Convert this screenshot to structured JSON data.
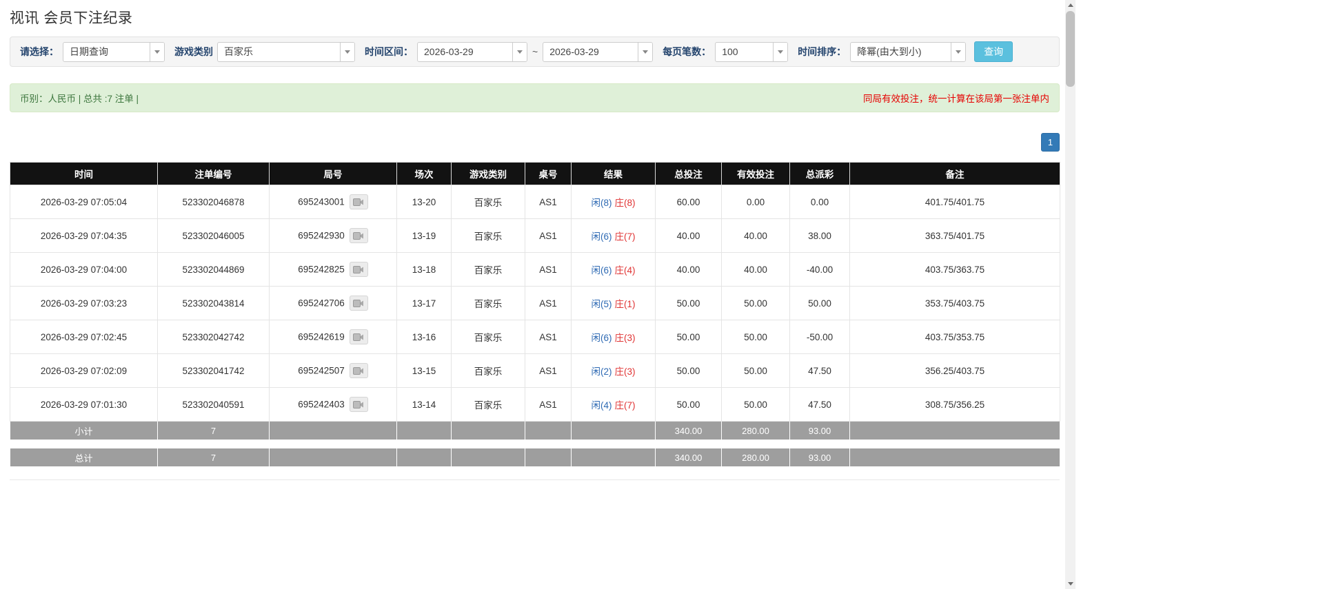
{
  "page": {
    "title": "视讯 会员下注纪录"
  },
  "filters": {
    "select_label": "请选择：",
    "select_value": "日期查询",
    "game_type_label": "游戏类别",
    "game_type_value": "百家乐",
    "time_range_label": "时间区间：",
    "date_from": "2026-03-29",
    "range_separator": "~",
    "date_to": "2026-03-29",
    "page_size_label": "每页笔数：",
    "page_size_value": "100",
    "sort_label": "时间排序：",
    "sort_value": "降幂(由大到小)",
    "search_button": "查询"
  },
  "summary": {
    "left": "币别：人民币 | 总共 :7 注单 |",
    "right": "同局有效投注，统一计算在该局第一张注单内"
  },
  "pagination": {
    "current": "1"
  },
  "table": {
    "headers": [
      "时间",
      "注单编号",
      "局号",
      "场次",
      "游戏类别",
      "桌号",
      "结果",
      "总投注",
      "有效投注",
      "总派彩",
      "备注"
    ],
    "rows": [
      {
        "time": "2026-03-29 07:05:04",
        "bet_id": "523302046878",
        "round": "695243001",
        "session": "13-20",
        "game": "百家乐",
        "table_no": "AS1",
        "player": "闲(8)",
        "banker": "庄(8)",
        "total_bet": "60.00",
        "valid_bet": "0.00",
        "payout": "0.00",
        "remark": "401.75/401.75"
      },
      {
        "time": "2026-03-29 07:04:35",
        "bet_id": "523302046005",
        "round": "695242930",
        "session": "13-19",
        "game": "百家乐",
        "table_no": "AS1",
        "player": "闲(6)",
        "banker": "庄(7)",
        "total_bet": "40.00",
        "valid_bet": "40.00",
        "payout": "38.00",
        "remark": "363.75/401.75"
      },
      {
        "time": "2026-03-29 07:04:00",
        "bet_id": "523302044869",
        "round": "695242825",
        "session": "13-18",
        "game": "百家乐",
        "table_no": "AS1",
        "player": "闲(6)",
        "banker": "庄(4)",
        "total_bet": "40.00",
        "valid_bet": "40.00",
        "payout": "-40.00",
        "remark": "403.75/363.75"
      },
      {
        "time": "2026-03-29 07:03:23",
        "bet_id": "523302043814",
        "round": "695242706",
        "session": "13-17",
        "game": "百家乐",
        "table_no": "AS1",
        "player": "闲(5)",
        "banker": "庄(1)",
        "total_bet": "50.00",
        "valid_bet": "50.00",
        "payout": "50.00",
        "remark": "353.75/403.75"
      },
      {
        "time": "2026-03-29 07:02:45",
        "bet_id": "523302042742",
        "round": "695242619",
        "session": "13-16",
        "game": "百家乐",
        "table_no": "AS1",
        "player": "闲(6)",
        "banker": "庄(3)",
        "total_bet": "50.00",
        "valid_bet": "50.00",
        "payout": "-50.00",
        "remark": "403.75/353.75"
      },
      {
        "time": "2026-03-29 07:02:09",
        "bet_id": "523302041742",
        "round": "695242507",
        "session": "13-15",
        "game": "百家乐",
        "table_no": "AS1",
        "player": "闲(2)",
        "banker": "庄(3)",
        "total_bet": "50.00",
        "valid_bet": "50.00",
        "payout": "47.50",
        "remark": "356.25/403.75"
      },
      {
        "time": "2026-03-29 07:01:30",
        "bet_id": "523302040591",
        "round": "695242403",
        "session": "13-14",
        "game": "百家乐",
        "table_no": "AS1",
        "player": "闲(4)",
        "banker": "庄(7)",
        "total_bet": "50.00",
        "valid_bet": "50.00",
        "payout": "47.50",
        "remark": "308.75/356.25"
      }
    ],
    "subtotal": {
      "label": "小计",
      "count": "7",
      "total_bet": "340.00",
      "valid_bet": "280.00",
      "payout": "93.00"
    },
    "total": {
      "label": "总计",
      "count": "7",
      "total_bet": "340.00",
      "valid_bet": "280.00",
      "payout": "93.00"
    }
  },
  "icons": {
    "dropdown": "chevron-down",
    "round_video": "video-camera",
    "scroll_up": "triangle-up",
    "scroll_down": "triangle-down"
  },
  "colors": {
    "accent_blue": "#337ab7",
    "search_button_bg": "#5bc0de",
    "summary_bg": "#dff0d8",
    "summary_text": "#3c763d",
    "warning_red": "#e60000",
    "table_header_bg": "#121212",
    "footer_row_bg": "#9e9e9e",
    "player_blue": "#2d69b3",
    "banker_red": "#e03333"
  }
}
